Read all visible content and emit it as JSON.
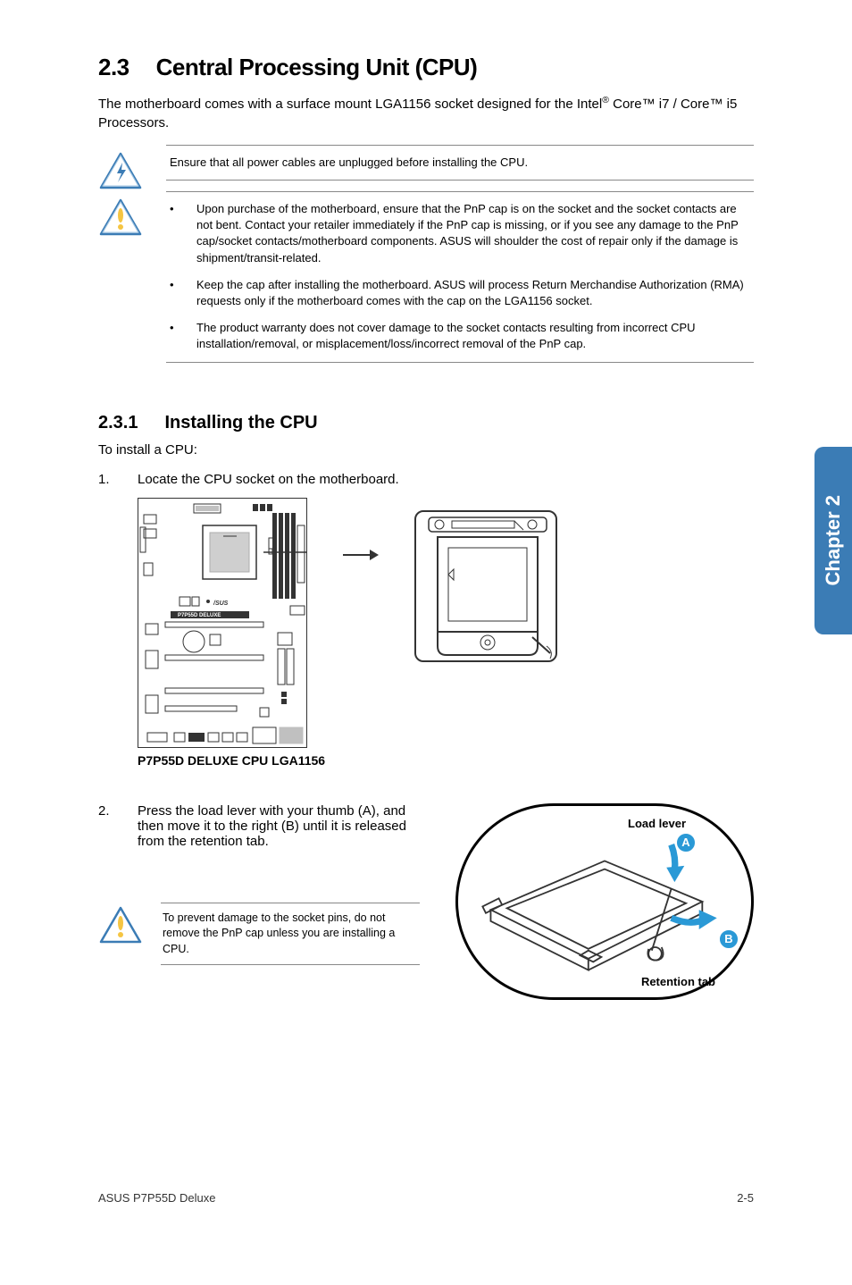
{
  "section": {
    "number": "2.3",
    "title": "Central Processing Unit (CPU)"
  },
  "intro": {
    "text_before_reg": "The motherboard comes with a surface mount LGA1156 socket designed for the Intel",
    "reg": "®",
    "text_after_reg": " Core™ i7 /  Core™ i5 Processors."
  },
  "danger_note": "Ensure that all power cables are unplugged before installing the CPU.",
  "caution_bullets": [
    "Upon purchase of the motherboard, ensure that the PnP cap is on the socket and the socket contacts are not bent. Contact your retailer immediately if the PnP cap is missing, or if you see any damage to the PnP cap/socket contacts/motherboard components. ASUS will shoulder the cost of repair only if the damage is shipment/transit-related.",
    "Keep the cap after installing the motherboard. ASUS will process Return Merchandise Authorization (RMA) requests only if the motherboard comes with the cap on the LGA1156 socket.",
    "The product warranty does not cover damage to the socket contacts resulting from incorrect CPU installation/removal, or misplacement/loss/incorrect removal of the PnP cap."
  ],
  "subsection": {
    "number": "2.3.1",
    "title": "Installing the CPU"
  },
  "install_intro": "To install a CPU:",
  "steps": {
    "s1_num": "1.",
    "s1_text": "Locate the CPU socket on the motherboard.",
    "s2_num": "2.",
    "s2_text": "Press the load lever with your thumb (A), and then move it to the right (B) until it is released from the retention tab."
  },
  "diagram": {
    "board_label": "P7P55D DELUXE",
    "caption": "P7P55D DELUXE CPU LGA1156",
    "load_lever": "Load lever",
    "retention_tab": "Retention tab",
    "label_a": "A",
    "label_b": "B"
  },
  "mini_caution": "To prevent damage to the socket pins, do not remove the PnP cap unless you are installing a CPU.",
  "side_tab": "Chapter 2",
  "footer": {
    "left": "ASUS P7P55D Deluxe",
    "right": "2-5"
  }
}
